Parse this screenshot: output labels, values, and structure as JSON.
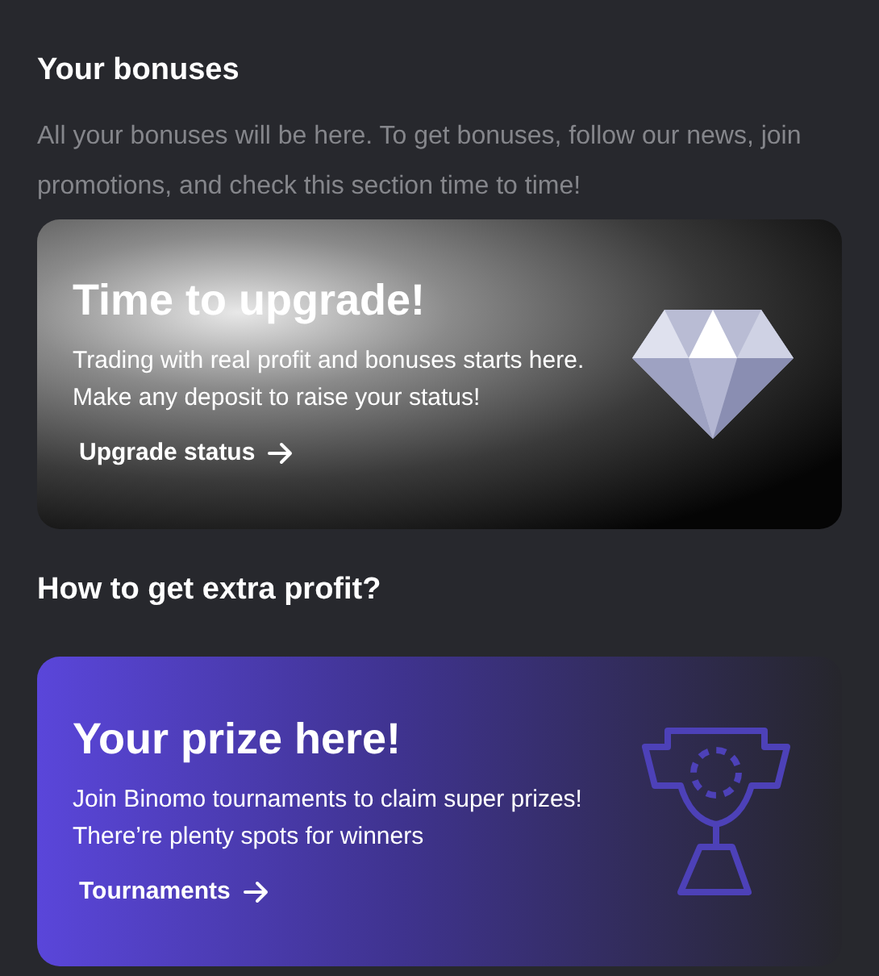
{
  "bonuses": {
    "title": "Your bonuses",
    "description": "All your bonuses will be here. To get bonuses, follow our news, join promotions, and check this section time to time!"
  },
  "cards": [
    {
      "kind": "upgrade",
      "title": "Time to upgrade!",
      "text": "Trading with real profit and bonuses starts here. Make any deposit to raise your status!",
      "link": "Upgrade status"
    }
  ],
  "extra": {
    "title": "How to get extra profit?"
  },
  "extra_cards": [
    {
      "kind": "tournament",
      "title": "Your prize here!",
      "text": "Join Binomo tournaments to claim super prizes! There’re plenty spots for winners",
      "link": "Tournaments"
    }
  ]
}
